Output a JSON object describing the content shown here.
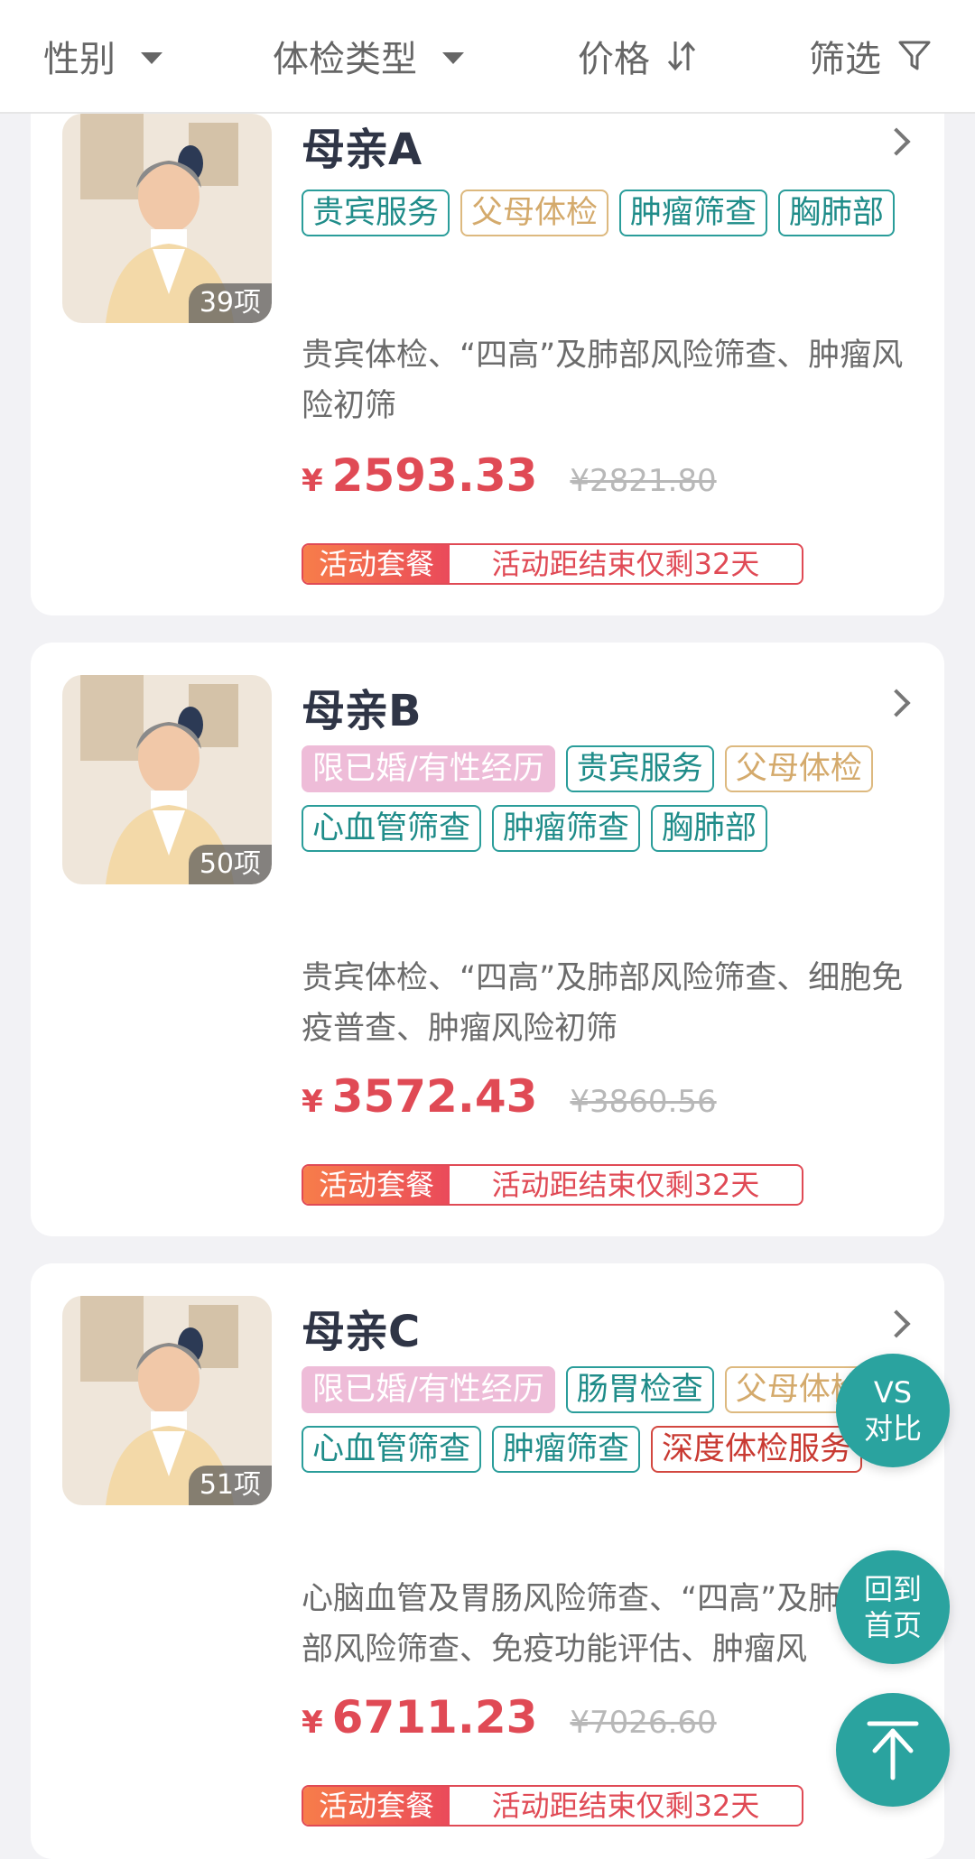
{
  "filters": [
    {
      "label": "性别",
      "icon": "caret-down-icon"
    },
    {
      "label": "体检类型",
      "icon": "caret-down-icon"
    },
    {
      "label": "价格",
      "icon": "sort-icon"
    },
    {
      "label": "筛选",
      "icon": "filter-icon"
    }
  ],
  "packages": [
    {
      "title": "母亲A",
      "count": "39项",
      "tags": [
        {
          "text": "贵宾服务",
          "style": "teal"
        },
        {
          "text": "父母体检",
          "style": "gold"
        },
        {
          "text": "肿瘤筛查",
          "style": "teal"
        },
        {
          "text": "胸肺部",
          "style": "teal"
        }
      ],
      "description": "贵宾体检、“四高”及肺部风险筛查、肿瘤风险初筛",
      "currency": "¥",
      "price": "2593.33",
      "original_price": "¥2821.80",
      "promo_label": "活动套餐",
      "promo_text": "活动距结束仅剩32天"
    },
    {
      "title": "母亲B",
      "count": "50项",
      "tags": [
        {
          "text": "限已婚/有性经历",
          "style": "pink"
        },
        {
          "text": "贵宾服务",
          "style": "teal"
        },
        {
          "text": "父母体检",
          "style": "gold"
        },
        {
          "text": "心血管筛查",
          "style": "teal"
        },
        {
          "text": "肿瘤筛查",
          "style": "teal"
        },
        {
          "text": "胸肺部",
          "style": "teal"
        }
      ],
      "description": "贵宾体检、“四高”及肺部风险筛查、细胞免疫普查、肿瘤风险初筛",
      "currency": "¥",
      "price": "3572.43",
      "original_price": "¥3860.56",
      "promo_label": "活动套餐",
      "promo_text": "活动距结束仅剩32天"
    },
    {
      "title": "母亲C",
      "count": "51项",
      "tags": [
        {
          "text": "限已婚/有性经历",
          "style": "pink"
        },
        {
          "text": "肠胃检查",
          "style": "teal"
        },
        {
          "text": "父母体检",
          "style": "gold"
        },
        {
          "text": "心血管筛查",
          "style": "teal"
        },
        {
          "text": "肿瘤筛查",
          "style": "teal"
        },
        {
          "text": "深度体检服务",
          "style": "red"
        }
      ],
      "description": "心脑血管及胃肠风险筛查、“四高”及肺部风险筛查、免疫功能评估、肿瘤风",
      "currency": "¥",
      "price": "6711.23",
      "original_price": "¥7026.60",
      "promo_label": "活动套餐",
      "promo_text": "活动距结束仅剩32天"
    }
  ],
  "fab": {
    "compare_line1": "VS",
    "compare_line2": "对比",
    "home_line1": "回到",
    "home_line2": "首页",
    "top_icon": "arrow-up-icon"
  },
  "colors": {
    "accent_teal": "#2aa39f",
    "price_red": "#e04a55",
    "tag_gold": "#d4aa6c",
    "tag_pink": "#eebcd8"
  }
}
